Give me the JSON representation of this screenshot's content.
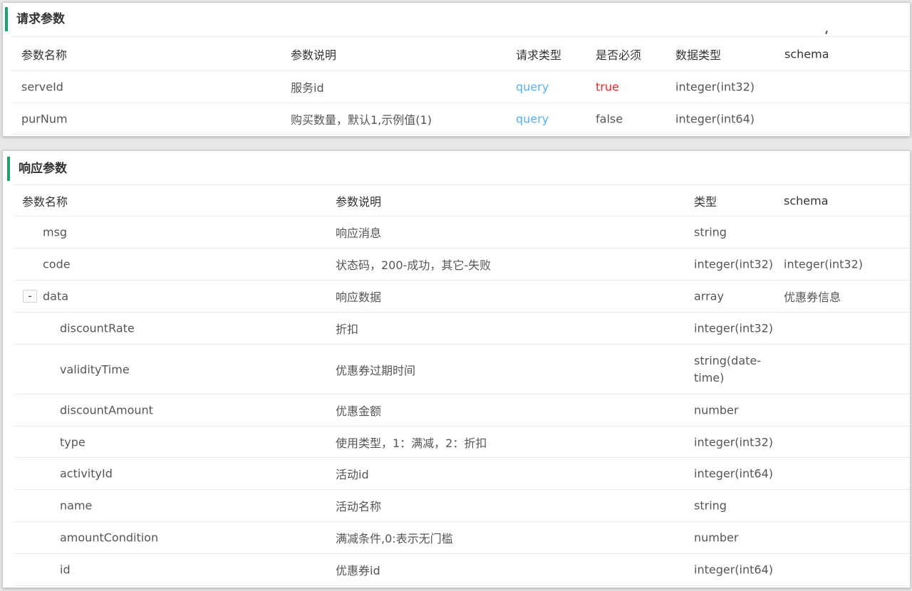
{
  "request": {
    "title": "请求参数",
    "headers": [
      "参数名称",
      "参数说明",
      "请求类型",
      "是否必须",
      "数据类型",
      "schema"
    ],
    "rows": [
      {
        "name": "serveId",
        "desc": "服务id",
        "in": "query",
        "required": "true",
        "type": "integer(int32)",
        "schema": ""
      },
      {
        "name": "purNum",
        "desc": "购买数量，默认1,示例值(1)",
        "in": "query",
        "required": "false",
        "type": "integer(int64)",
        "schema": ""
      }
    ]
  },
  "response": {
    "title": "响应参数",
    "headers": [
      "参数名称",
      "参数说明",
      "类型",
      "schema"
    ],
    "toggle": "-",
    "rows": [
      {
        "name": "msg",
        "desc": "响应消息",
        "type": "string",
        "schema": ""
      },
      {
        "name": "code",
        "desc": "状态码，200-成功，其它-失败",
        "type": "integer(int32)",
        "schema": "integer(int32)"
      },
      {
        "name": "data",
        "desc": "响应数据",
        "type": "array",
        "schema": "优惠券信息"
      },
      {
        "name": "discountRate",
        "desc": "折扣",
        "type": "integer(int32)",
        "schema": ""
      },
      {
        "name": "validityTime",
        "desc": "优惠券过期时间",
        "type": "string(date-time)",
        "schema": ""
      },
      {
        "name": "discountAmount",
        "desc": "优惠金额",
        "type": "number",
        "schema": ""
      },
      {
        "name": "type",
        "desc": "使用类型，1：满减，2：折扣",
        "type": "integer(int32)",
        "schema": ""
      },
      {
        "name": "activityId",
        "desc": "活动id",
        "type": "integer(int64)",
        "schema": ""
      },
      {
        "name": "name",
        "desc": "活动名称",
        "type": "string",
        "schema": ""
      },
      {
        "name": "amountCondition",
        "desc": "满减条件,0:表示无门槛",
        "type": "number",
        "schema": ""
      },
      {
        "name": "id",
        "desc": "优惠券id",
        "type": "integer(int64)",
        "schema": ""
      }
    ]
  },
  "colors": {
    "accent": "#1aa36b",
    "query": "#5ab0f5",
    "required_true": "#e5262c"
  }
}
